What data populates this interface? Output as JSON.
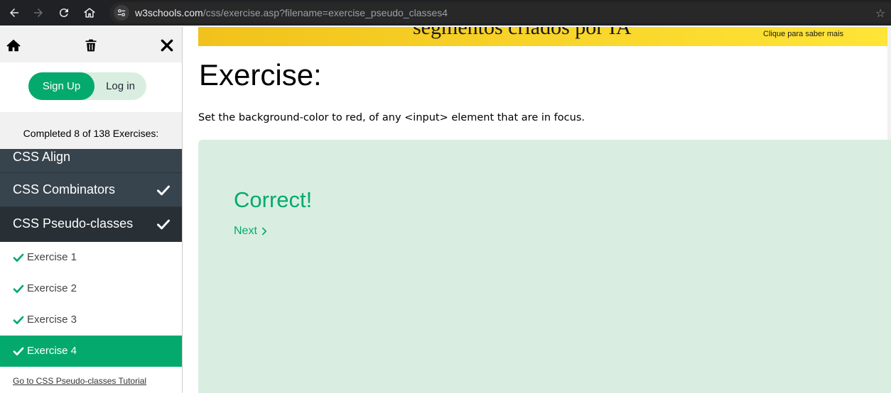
{
  "browser": {
    "url_domain": "w3schools.com",
    "url_path": "/css/exercise.asp?filename=exercise_pseudo_classes4"
  },
  "sidebar": {
    "auth": {
      "signup_label": "Sign Up",
      "login_label": "Log in"
    },
    "progress_text": "Completed 8 of 138 Exercises:",
    "sections": [
      {
        "label": "CSS Align",
        "completed": false
      },
      {
        "label": "CSS Combinators",
        "completed": true
      },
      {
        "label": "CSS Pseudo-classes",
        "completed": true,
        "expanded": true
      }
    ],
    "exercises": [
      {
        "label": "Exercise 1",
        "completed": true,
        "active": false
      },
      {
        "label": "Exercise 2",
        "completed": true,
        "active": false
      },
      {
        "label": "Exercise 3",
        "completed": true,
        "active": false
      },
      {
        "label": "Exercise 4",
        "completed": true,
        "active": true
      }
    ],
    "tutorial_link": "Go to CSS Pseudo-classes Tutorial"
  },
  "ad": {
    "title": "segmentos criados por IA",
    "cta": "Clique para saber mais"
  },
  "main": {
    "title": "Exercise:",
    "instruction": "Set the background-color to red, of any <input> element that are in focus.",
    "result_title": "Correct!",
    "next_label": "Next"
  },
  "colors": {
    "accent": "#04aa6d",
    "sidebar_section": "#38444d",
    "result_bg": "#d9eee1"
  }
}
